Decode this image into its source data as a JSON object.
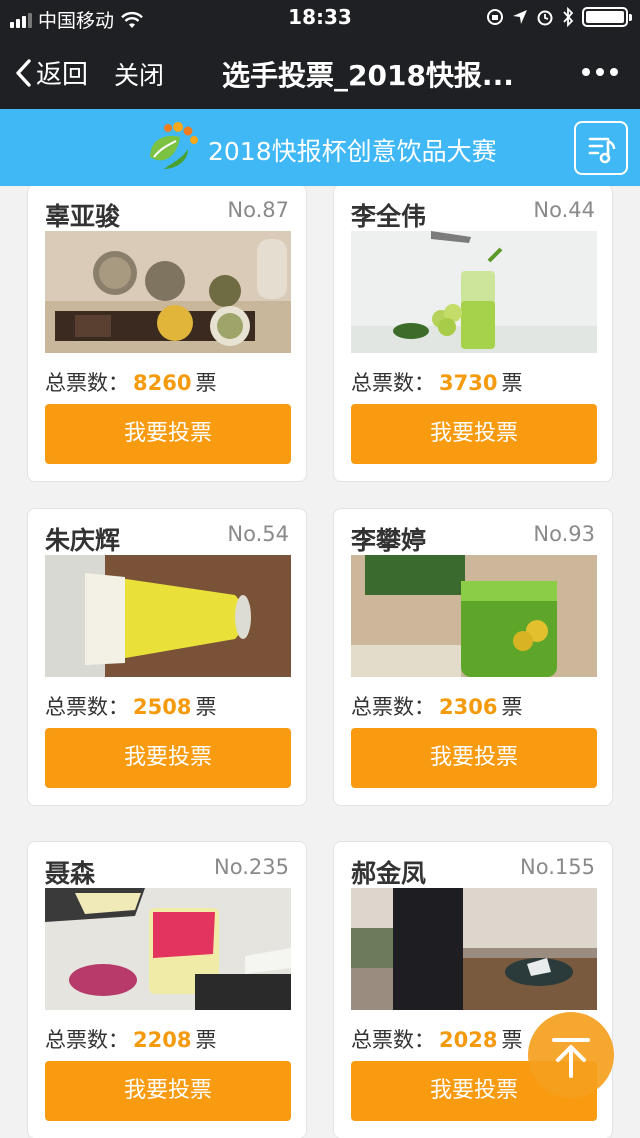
{
  "status": {
    "carrier": "中国移动",
    "time": "18:33"
  },
  "nav": {
    "back_label": "返回",
    "close_label": "关闭",
    "title": "选手投票_2018快报..."
  },
  "banner": {
    "title": "2018快报杯创意饮品大赛"
  },
  "contestants": [
    {
      "name": "辜亚骏",
      "no": "No.87",
      "votes_label": "总票数：",
      "votes": "8260",
      "unit": "票",
      "button": "我要投票"
    },
    {
      "name": "李全伟",
      "no": "No.44",
      "votes_label": "总票数：",
      "votes": "3730",
      "unit": "票",
      "button": "我要投票"
    },
    {
      "name": "朱庆辉",
      "no": "No.54",
      "votes_label": "总票数：",
      "votes": "2508",
      "unit": "票",
      "button": "我要投票"
    },
    {
      "name": "李攀婷",
      "no": "No.93",
      "votes_label": "总票数：",
      "votes": "2306",
      "unit": "票",
      "button": "我要投票"
    },
    {
      "name": "聂森",
      "no": "No.235",
      "votes_label": "总票数：",
      "votes": "2208",
      "unit": "票",
      "button": "我要投票"
    },
    {
      "name": "郝金凤",
      "no": "No.155",
      "votes_label": "总票数：",
      "votes": "2028",
      "unit": "票",
      "button": "我要投票"
    }
  ],
  "icons": {
    "back": "chevron-left-icon",
    "more": "more-dots-icon",
    "menu": "music-list-icon",
    "top": "back-to-top-icon"
  },
  "colors": {
    "accent": "#f89b10",
    "vote_number": "#f49a0c",
    "banner": "#3fb8f5",
    "nav": "#1f2023"
  }
}
